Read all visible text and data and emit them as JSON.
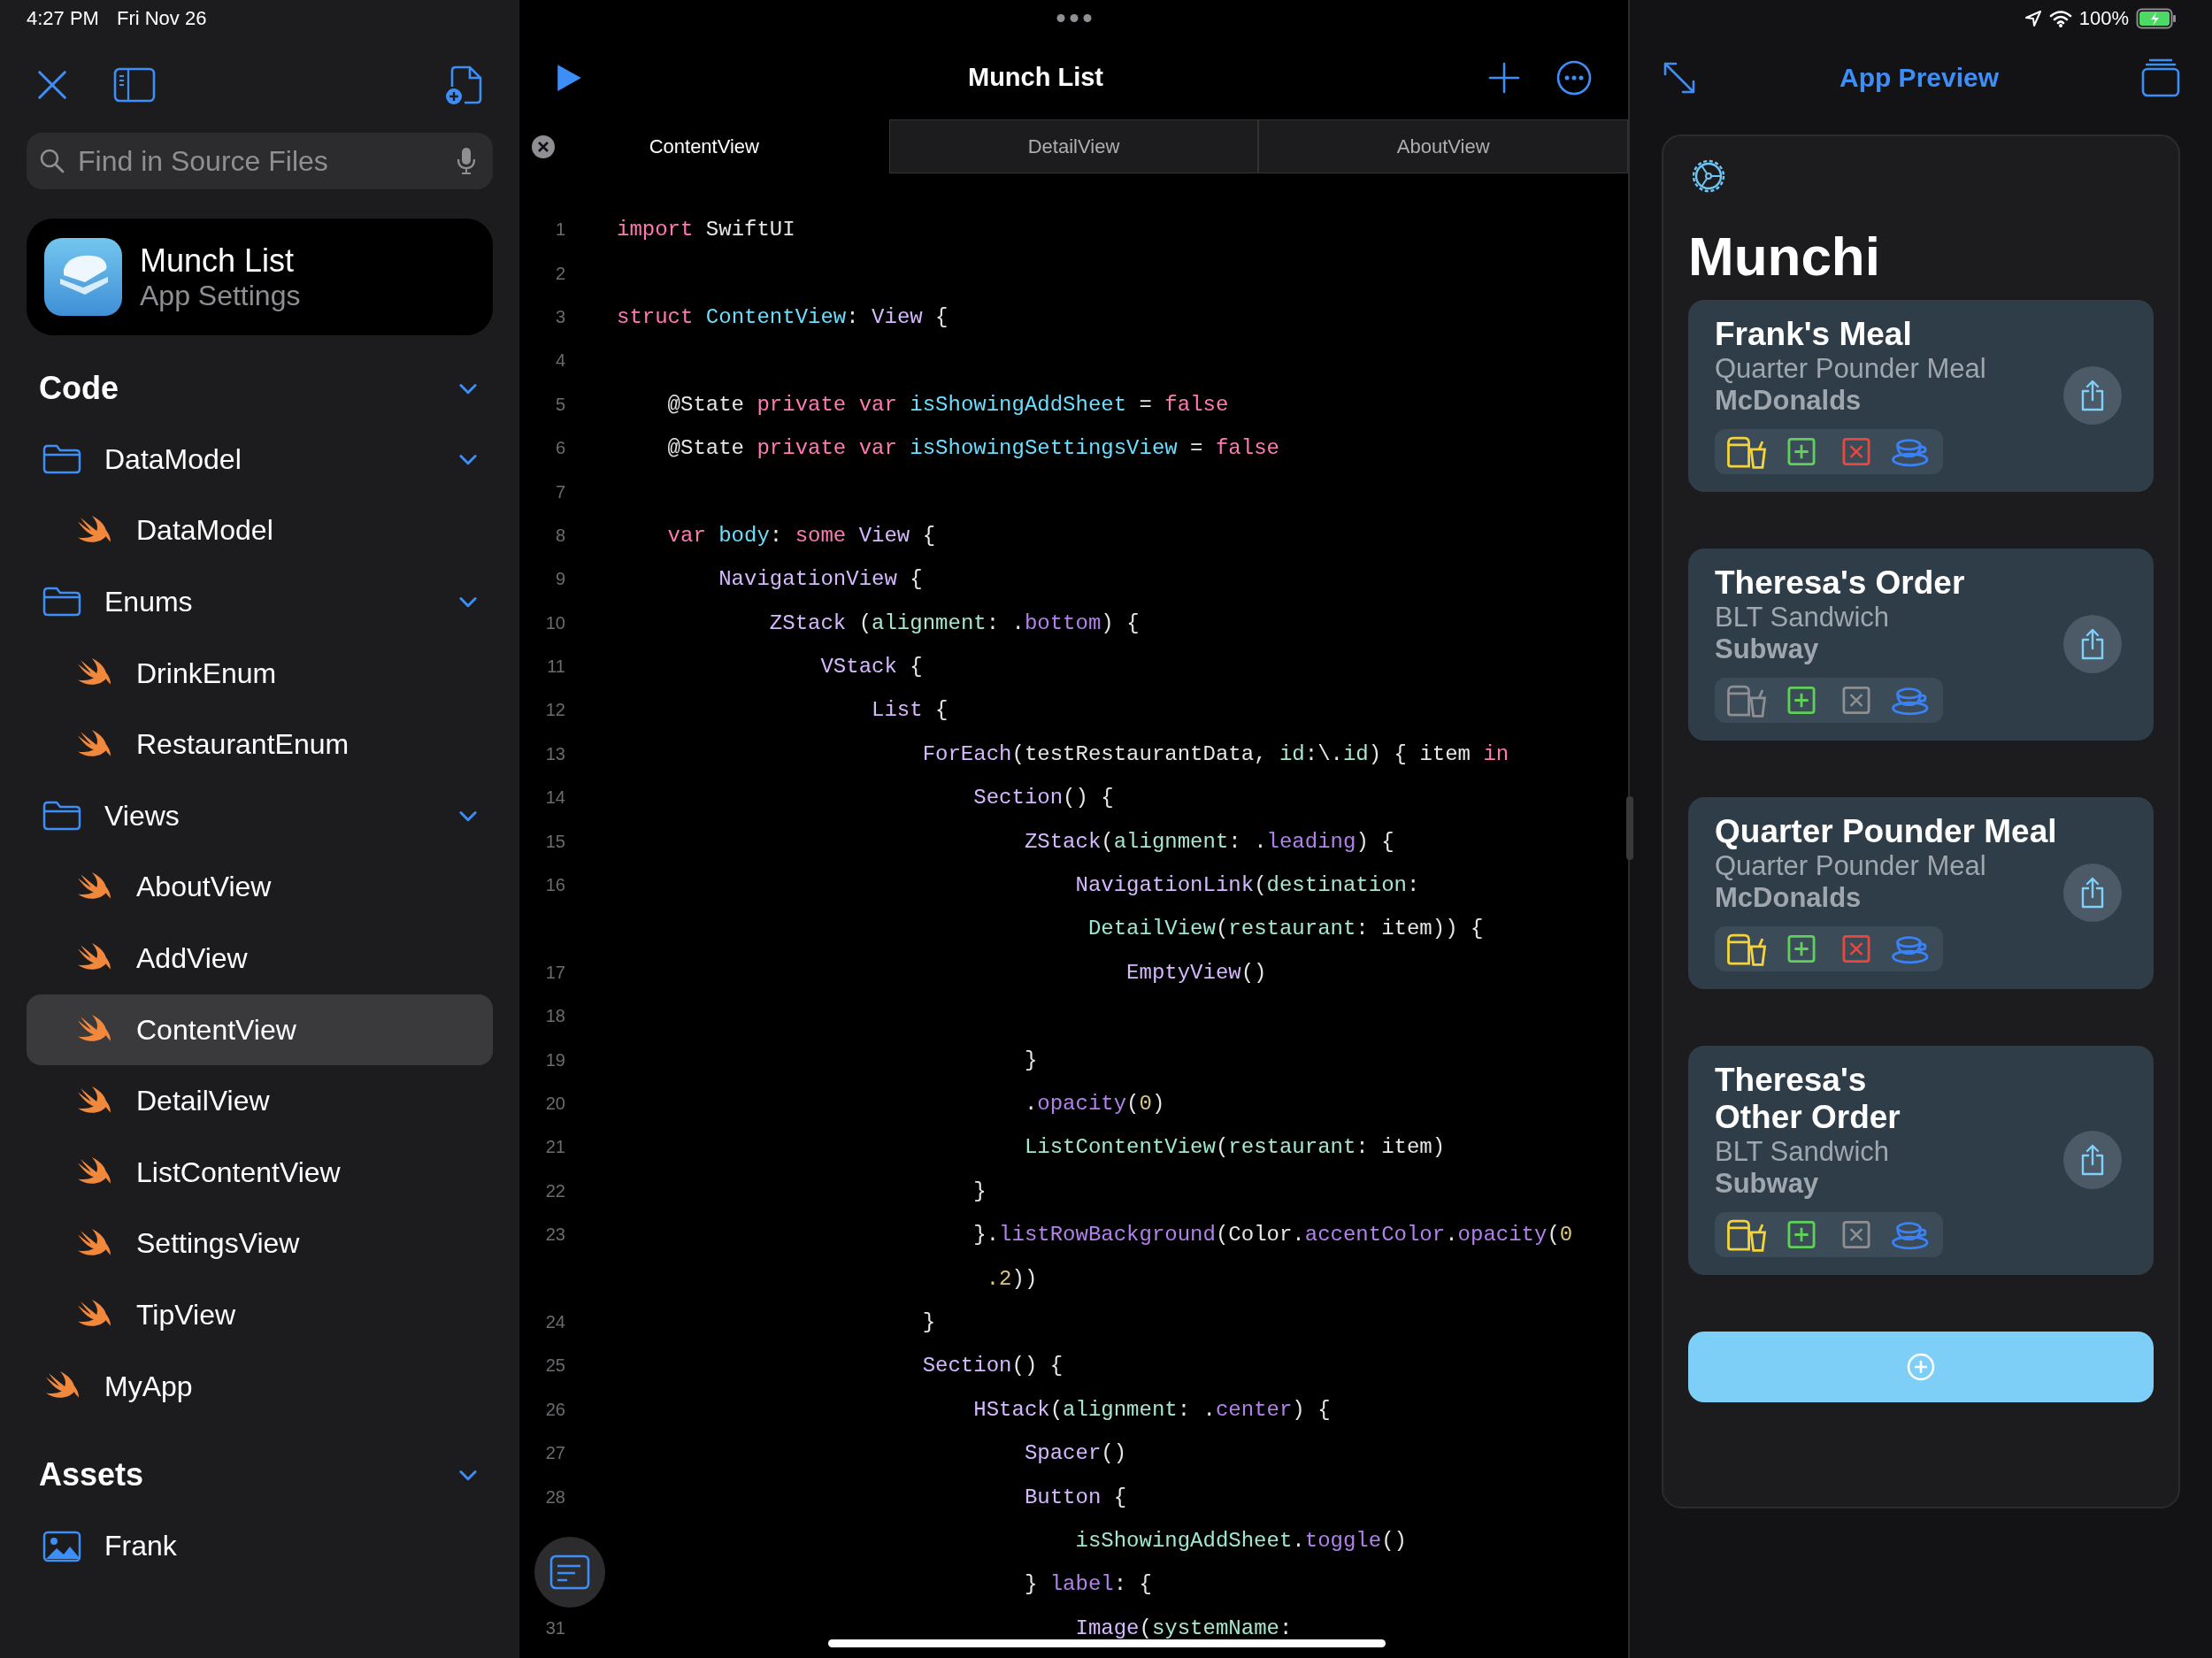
{
  "status_bar": {
    "time": "4:27 PM",
    "date": "Fri Nov 26",
    "battery": "100%"
  },
  "sidebar": {
    "search": {
      "placeholder": "Find in Source Files"
    },
    "project": {
      "name": "Munch List",
      "subtitle": "App Settings"
    },
    "sections": [
      {
        "title": "Code",
        "expanded": true,
        "items": [
          {
            "kind": "folder",
            "label": "DataModel",
            "expanded": true,
            "selected": false,
            "children": [
              {
                "kind": "swift",
                "label": "DataModel",
                "selected": false
              }
            ]
          },
          {
            "kind": "folder",
            "label": "Enums",
            "expanded": true,
            "selected": false,
            "children": [
              {
                "kind": "swift",
                "label": "DrinkEnum",
                "selected": false
              },
              {
                "kind": "swift",
                "label": "RestaurantEnum",
                "selected": false
              }
            ]
          },
          {
            "kind": "folder",
            "label": "Views",
            "expanded": true,
            "selected": false,
            "children": [
              {
                "kind": "swift",
                "label": "AboutView",
                "selected": false
              },
              {
                "kind": "swift",
                "label": "AddView",
                "selected": false
              },
              {
                "kind": "swift",
                "label": "ContentView",
                "selected": true
              },
              {
                "kind": "swift",
                "label": "DetailView",
                "selected": false
              },
              {
                "kind": "swift",
                "label": "ListContentView",
                "selected": false
              },
              {
                "kind": "swift",
                "label": "SettingsView",
                "selected": false
              },
              {
                "kind": "swift",
                "label": "TipView",
                "selected": false
              }
            ]
          },
          {
            "kind": "swift",
            "label": "MyApp",
            "selected": false
          }
        ]
      },
      {
        "title": "Assets",
        "expanded": true,
        "items": [
          {
            "kind": "image",
            "label": "Frank",
            "selected": false
          }
        ]
      }
    ]
  },
  "editor": {
    "title": "Munch List",
    "tabs": [
      {
        "label": "ContentView",
        "selected": true
      },
      {
        "label": "DetailView",
        "selected": false
      },
      {
        "label": "AboutView",
        "selected": false
      }
    ],
    "lines": [
      {
        "n": "1",
        "tokens": [
          {
            "kind": "kw",
            "text": "import"
          },
          {
            "kind": "plain",
            "text": " SwiftUI"
          }
        ]
      },
      {
        "n": "2"
      },
      {
        "n": "3",
        "tokens": [
          {
            "kind": "kw",
            "text": "struct "
          },
          {
            "kind": "decl",
            "text": "ContentView"
          },
          {
            "kind": "plain",
            "text": ": "
          },
          {
            "kind": "type",
            "text": "View"
          },
          {
            "kind": "plain",
            "text": " {"
          }
        ]
      },
      {
        "n": "4"
      },
      {
        "n": "5",
        "tokens": [
          {
            "kind": "plain",
            "text": "    @State "
          },
          {
            "kind": "kw",
            "text": "private var "
          },
          {
            "kind": "decl",
            "text": "isShowingAddSheet"
          },
          {
            "kind": "plain",
            "text": " = "
          },
          {
            "kind": "kw",
            "text": "false"
          }
        ]
      },
      {
        "n": "6",
        "tokens": [
          {
            "kind": "plain",
            "text": "    @State "
          },
          {
            "kind": "kw",
            "text": "private var "
          },
          {
            "kind": "decl",
            "text": "isShowingSettingsView"
          },
          {
            "kind": "plain",
            "text": " = "
          },
          {
            "kind": "kw",
            "text": "false"
          }
        ]
      },
      {
        "n": "7"
      },
      {
        "n": "8",
        "tokens": [
          {
            "kind": "kw",
            "text": "    var "
          },
          {
            "kind": "decl",
            "text": "body"
          },
          {
            "kind": "plain",
            "text": ": "
          },
          {
            "kind": "kw",
            "text": "some "
          },
          {
            "kind": "type",
            "text": "View"
          },
          {
            "kind": "plain",
            "text": " {"
          }
        ]
      },
      {
        "n": "9",
        "tokens": [
          {
            "kind": "type",
            "text": "        NavigationView"
          },
          {
            "kind": "plain",
            "text": " {"
          }
        ]
      },
      {
        "n": "10",
        "tokens": [
          {
            "kind": "type",
            "text": "            ZStack"
          },
          {
            "kind": "plain",
            "text": " ("
          },
          {
            "kind": "param",
            "text": "alignment"
          },
          {
            "kind": "plain",
            "text": ": ."
          },
          {
            "kind": "member",
            "text": "bottom"
          },
          {
            "kind": "plain",
            "text": ") {"
          }
        ]
      },
      {
        "n": "11",
        "tokens": [
          {
            "kind": "type",
            "text": "                VStack"
          },
          {
            "kind": "plain",
            "text": " {"
          }
        ]
      },
      {
        "n": "12",
        "tokens": [
          {
            "kind": "type",
            "text": "                    List"
          },
          {
            "kind": "plain",
            "text": " {"
          }
        ]
      },
      {
        "n": "13",
        "tokens": [
          {
            "kind": "type",
            "text": "                        ForEach"
          },
          {
            "kind": "plain",
            "text": "(testRestaurantData, "
          },
          {
            "kind": "param",
            "text": "id"
          },
          {
            "kind": "plain",
            "text": ":\\."
          },
          {
            "kind": "param",
            "text": "id"
          },
          {
            "kind": "plain",
            "text": ") { item "
          },
          {
            "kind": "kw",
            "text": "in"
          }
        ]
      },
      {
        "n": "14",
        "tokens": [
          {
            "kind": "type",
            "text": "                            Section"
          },
          {
            "kind": "plain",
            "text": "() {"
          }
        ]
      },
      {
        "n": "15",
        "tokens": [
          {
            "kind": "type",
            "text": "                                ZStack"
          },
          {
            "kind": "plain",
            "text": "("
          },
          {
            "kind": "param",
            "text": "alignment"
          },
          {
            "kind": "plain",
            "text": ": ."
          },
          {
            "kind": "member",
            "text": "leading"
          },
          {
            "kind": "plain",
            "text": ") {"
          }
        ]
      },
      {
        "n": "16",
        "tokens": [
          {
            "kind": "type",
            "text": "                                    NavigationLink"
          },
          {
            "kind": "plain",
            "text": "("
          },
          {
            "kind": "param",
            "text": "destination"
          },
          {
            "kind": "plain",
            "text": ":"
          }
        ]
      },
      {
        "tokens": [
          {
            "kind": "proj",
            "text": "                                     DetailView"
          },
          {
            "kind": "plain",
            "text": "("
          },
          {
            "kind": "param",
            "text": "restaurant"
          },
          {
            "kind": "plain",
            "text": ": item)) {"
          }
        ]
      },
      {
        "n": "17",
        "tokens": [
          {
            "kind": "type",
            "text": "                                        EmptyView"
          },
          {
            "kind": "plain",
            "text": "()"
          }
        ]
      },
      {
        "n": "18"
      },
      {
        "n": "19",
        "tokens": [
          {
            "kind": "plain",
            "text": "                                }"
          }
        ]
      },
      {
        "n": "20",
        "tokens": [
          {
            "kind": "plain",
            "text": "                                ."
          },
          {
            "kind": "member",
            "text": "opacity"
          },
          {
            "kind": "plain",
            "text": "("
          },
          {
            "kind": "num",
            "text": "0"
          },
          {
            "kind": "plain",
            "text": ")"
          }
        ]
      },
      {
        "n": "21",
        "tokens": [
          {
            "kind": "proj",
            "text": "                                ListContentView"
          },
          {
            "kind": "plain",
            "text": "("
          },
          {
            "kind": "param",
            "text": "restaurant"
          },
          {
            "kind": "plain",
            "text": ": item)"
          }
        ]
      },
      {
        "n": "22",
        "tokens": [
          {
            "kind": "plain",
            "text": "                            }"
          }
        ]
      },
      {
        "n": "23",
        "tokens": [
          {
            "kind": "plain",
            "text": "                            }."
          },
          {
            "kind": "member",
            "text": "listRowBackground"
          },
          {
            "kind": "plain",
            "text": "(Color."
          },
          {
            "kind": "member",
            "text": "accentColor"
          },
          {
            "kind": "plain",
            "text": "."
          },
          {
            "kind": "member",
            "text": "opacity"
          },
          {
            "kind": "plain",
            "text": "("
          },
          {
            "kind": "num",
            "text": "0"
          }
        ]
      },
      {
        "tokens": [
          {
            "kind": "num",
            "text": "                             .2"
          },
          {
            "kind": "plain",
            "text": "))"
          }
        ]
      },
      {
        "n": "24",
        "tokens": [
          {
            "kind": "plain",
            "text": "                        }"
          }
        ]
      },
      {
        "n": "25",
        "tokens": [
          {
            "kind": "type",
            "text": "                        Section"
          },
          {
            "kind": "plain",
            "text": "() {"
          }
        ]
      },
      {
        "n": "26",
        "tokens": [
          {
            "kind": "type",
            "text": "                            HStack"
          },
          {
            "kind": "plain",
            "text": "("
          },
          {
            "kind": "param",
            "text": "alignment"
          },
          {
            "kind": "plain",
            "text": ": ."
          },
          {
            "kind": "member",
            "text": "center"
          },
          {
            "kind": "plain",
            "text": ") {"
          }
        ]
      },
      {
        "n": "27",
        "tokens": [
          {
            "kind": "type",
            "text": "                                Spacer"
          },
          {
            "kind": "plain",
            "text": "()"
          }
        ]
      },
      {
        "n": "28",
        "tokens": [
          {
            "kind": "type",
            "text": "                                Button"
          },
          {
            "kind": "plain",
            "text": " {"
          }
        ]
      },
      {
        "tokens": [
          {
            "kind": "proj",
            "text": "                                    isShowingAddSheet"
          },
          {
            "kind": "plain",
            "text": "."
          },
          {
            "kind": "member",
            "text": "toggle"
          },
          {
            "kind": "plain",
            "text": "()"
          }
        ]
      },
      {
        "tokens": [
          {
            "kind": "plain",
            "text": "                                } "
          },
          {
            "kind": "member",
            "text": "label"
          },
          {
            "kind": "plain",
            "text": ": {"
          }
        ]
      },
      {
        "n": "31",
        "tokens": [
          {
            "kind": "type",
            "text": "                                    Image"
          },
          {
            "kind": "plain",
            "text": "("
          },
          {
            "kind": "param",
            "text": "systemName"
          },
          {
            "kind": "plain",
            "text": ":"
          }
        ]
      }
    ]
  },
  "preview": {
    "title": "App Preview",
    "app_title": "Munchi",
    "orders": [
      {
        "title": "Frank's Meal",
        "item": "Quarter Pounder Meal",
        "restaurant": "McDonalds",
        "flags": [
          {
            "kind": "takeout",
            "on": true
          },
          {
            "kind": "extras",
            "on": true
          },
          {
            "kind": "nofood",
            "on": true
          },
          {
            "kind": "dinein",
            "on": true
          }
        ]
      },
      {
        "title": "Theresa's Order",
        "item": "BLT Sandwich",
        "restaurant": "Subway",
        "flags": [
          {
            "kind": "takeout",
            "on": false
          },
          {
            "kind": "extras",
            "on": true
          },
          {
            "kind": "nofood",
            "on": false
          },
          {
            "kind": "dinein",
            "on": true
          }
        ]
      },
      {
        "title": "Quarter Pounder Meal",
        "item": "Quarter Pounder Meal",
        "restaurant": "McDonalds",
        "flags": [
          {
            "kind": "takeout",
            "on": true
          },
          {
            "kind": "extras",
            "on": true
          },
          {
            "kind": "nofood",
            "on": true
          },
          {
            "kind": "dinein",
            "on": true
          }
        ]
      },
      {
        "title": "Theresa's\nOther Order",
        "item": "BLT Sandwich",
        "restaurant": "Subway",
        "flags": [
          {
            "kind": "takeout",
            "on": true
          },
          {
            "kind": "extras",
            "on": true
          },
          {
            "kind": "nofood",
            "on": false
          },
          {
            "kind": "dinein",
            "on": true
          }
        ]
      }
    ]
  }
}
